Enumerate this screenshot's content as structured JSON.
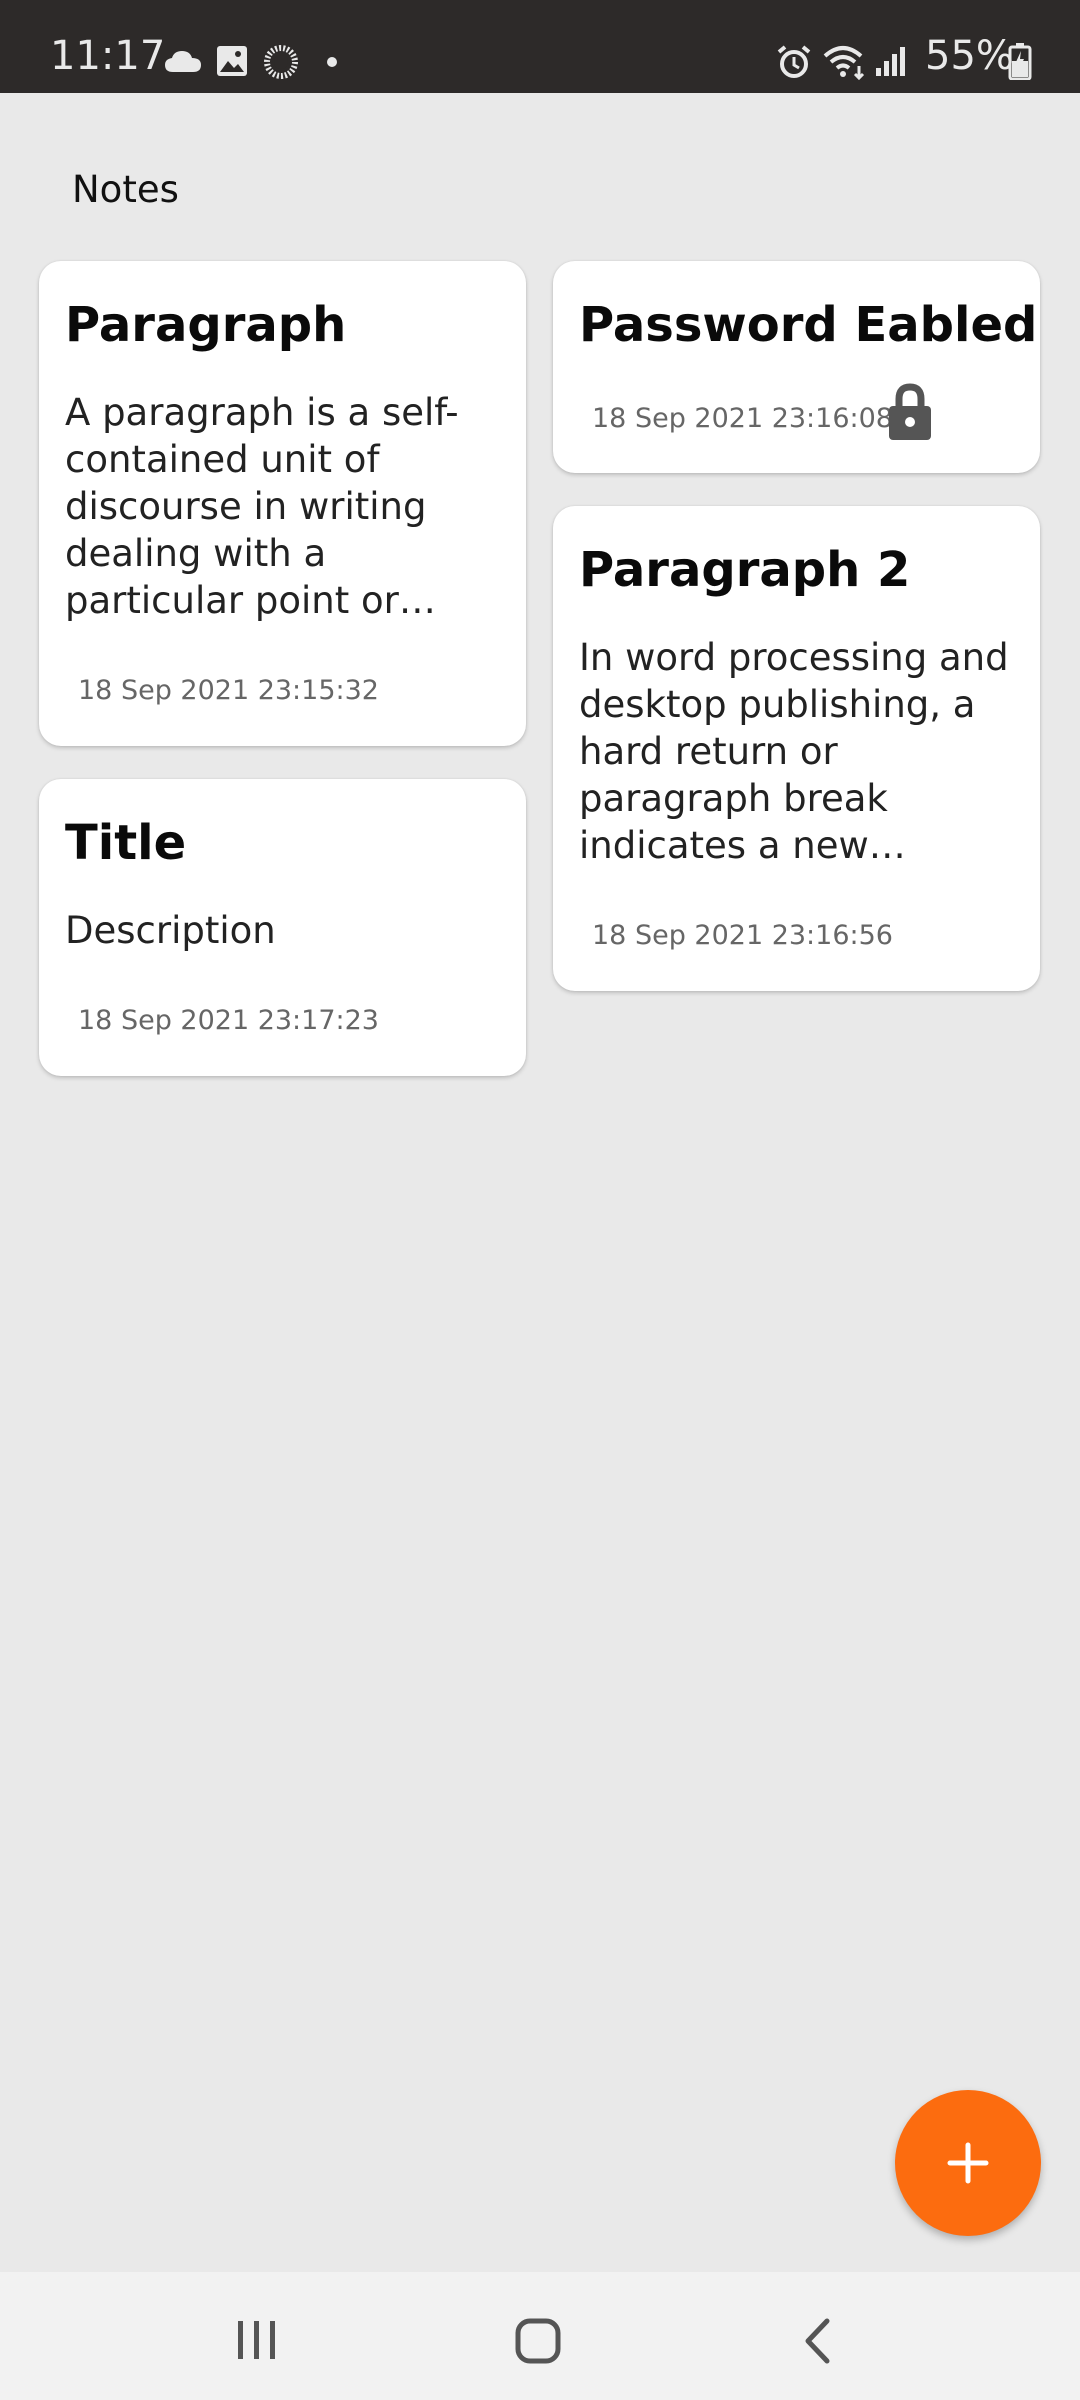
{
  "status_bar": {
    "time": "11:17",
    "battery": "55%",
    "icons": [
      "cloud-icon",
      "image-icon",
      "sync-icon",
      "dot-icon",
      "alarm-icon",
      "wifi-icon",
      "signal-icon",
      "battery-icon"
    ]
  },
  "header": {
    "title": "Notes"
  },
  "notes": [
    {
      "title": "Paragraph",
      "body": "A  paragraph is a self-contained unit of discourse in writing dealing with a particular point or idea. A paragraph consists of one or more sentences.",
      "date": "18 Sep 2021 23:15:32",
      "locked": false
    },
    {
      "title": "Password Eabled",
      "body": "",
      "date": "18 Sep 2021 23:16:08",
      "locked": true
    },
    {
      "title": "Paragraph 2",
      "body": "In word processing and desktop publishing, a hard return or paragraph break indicates a new paragraph, to be distinguished from the soft return.",
      "date": "18 Sep 2021 23:16:56",
      "locked": false
    },
    {
      "title": "Title",
      "body": "Description",
      "date": "18 Sep 2021 23:17:23",
      "locked": false
    }
  ],
  "fab": {
    "icon": "plus-icon",
    "color": "#fc6c0f"
  },
  "nav_bar": {
    "buttons": [
      "recent-apps-icon",
      "home-icon",
      "back-icon"
    ]
  },
  "colors": {
    "status_bar": "#2d2a29",
    "background": "#e9e9e9",
    "card": "#ffffff",
    "accent": "#fc6c0f"
  }
}
